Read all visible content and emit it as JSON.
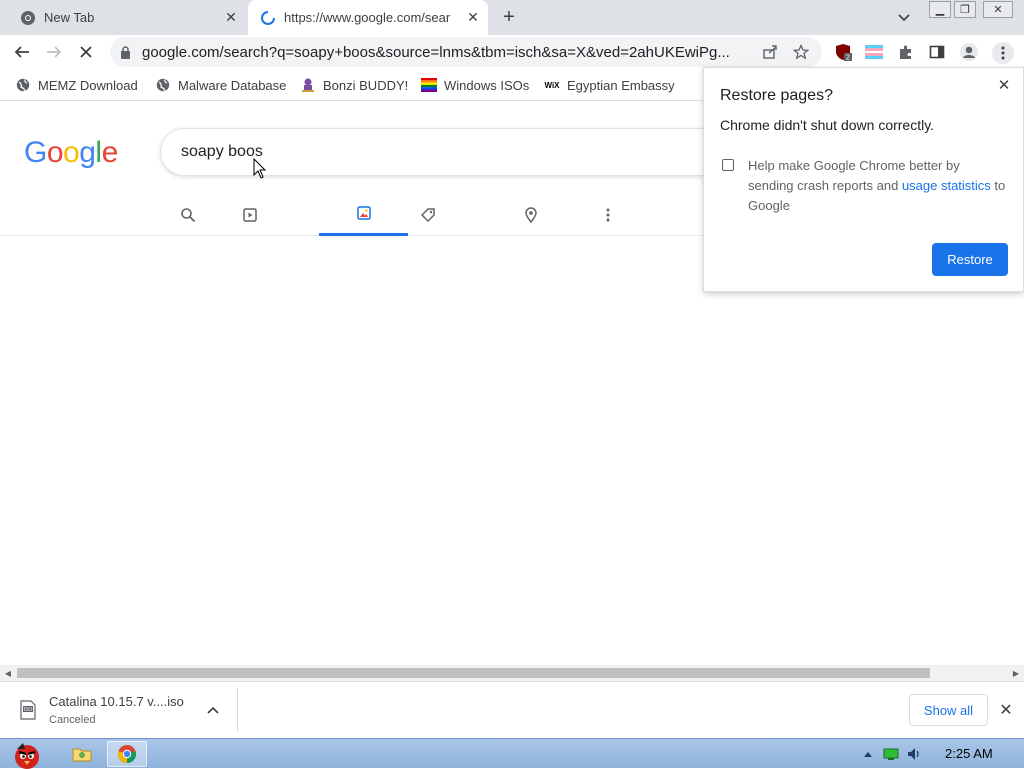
{
  "browser": {
    "tabs": [
      {
        "title": "New Tab",
        "icon": "chrome-icon",
        "active": false
      },
      {
        "title": "https://www.google.com/sear",
        "icon": "loading-spinner-icon",
        "active": true
      }
    ],
    "url": "google.com/search?q=soapy+boos&source=lnms&tbm=isch&sa=X&ved=2ahUKEwiPg...",
    "extension_badge": "2"
  },
  "bookmarks": [
    {
      "label": "MEMZ Download",
      "icon": "globe-icon"
    },
    {
      "label": "Malware Database",
      "icon": "globe-icon"
    },
    {
      "label": "Bonzi BUDDY!",
      "icon": "bonzi-icon"
    },
    {
      "label": "Windows ISOs",
      "icon": "rainbow-flag-icon"
    },
    {
      "label": "Egyptian Embassy",
      "icon": "wix-icon"
    }
  ],
  "search": {
    "query": "soapy boos",
    "selected_tab": "images"
  },
  "popup": {
    "title": "Restore pages?",
    "message": "Chrome didn't shut down correctly.",
    "checkbox_text": "Help make Google Chrome better by sending crash reports and ",
    "checkbox_link": "usage statistics",
    "checkbox_text_end": " to Google",
    "checkbox_checked": false,
    "restore_label": "Restore"
  },
  "downloads": {
    "file_name": "Catalina 10.15.7 v....iso",
    "status": "Canceled",
    "show_all_label": "Show all"
  },
  "taskbar": {
    "time": "2:25 AM"
  },
  "colors": {
    "accent": "#1a73e8",
    "tabstrip": "#dee1e6"
  }
}
